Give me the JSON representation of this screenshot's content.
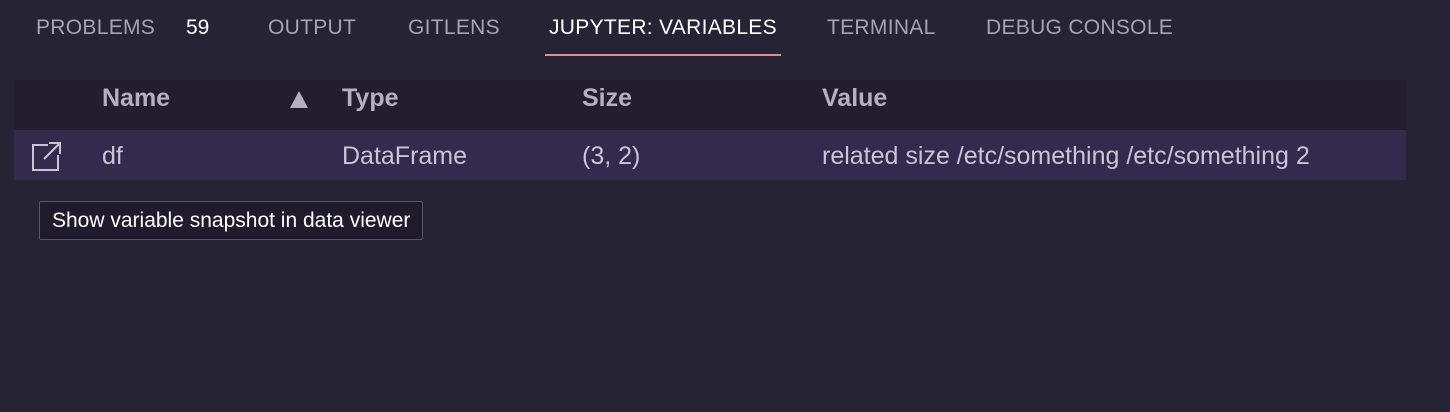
{
  "tabs": [
    {
      "label": "PROBLEMS",
      "badge": "59",
      "active": false
    },
    {
      "label": "OUTPUT",
      "active": false
    },
    {
      "label": "GITLENS",
      "active": false
    },
    {
      "label": "JUPYTER: VARIABLES",
      "active": true
    },
    {
      "label": "TERMINAL",
      "active": false
    },
    {
      "label": "DEBUG CONSOLE",
      "active": false
    }
  ],
  "variables": {
    "columns": {
      "name": "Name",
      "type": "Type",
      "size": "Size",
      "value": "Value"
    },
    "sort": {
      "column": "Name",
      "direction": "ascending",
      "icon": "sort-ascending-icon"
    },
    "rows": [
      {
        "name": "df",
        "type": "DataFrame",
        "size": "(3, 2)",
        "value": "related size /etc/something /etc/something 2",
        "icon": "open-in-data-viewer-icon"
      }
    ]
  },
  "tooltip": {
    "text": "Show variable snapshot in data viewer"
  },
  "colors": {
    "background": "#262335",
    "header_background": "#221e30",
    "row_background": "#332a4d",
    "active_tab_underline": "#e88a8a"
  }
}
